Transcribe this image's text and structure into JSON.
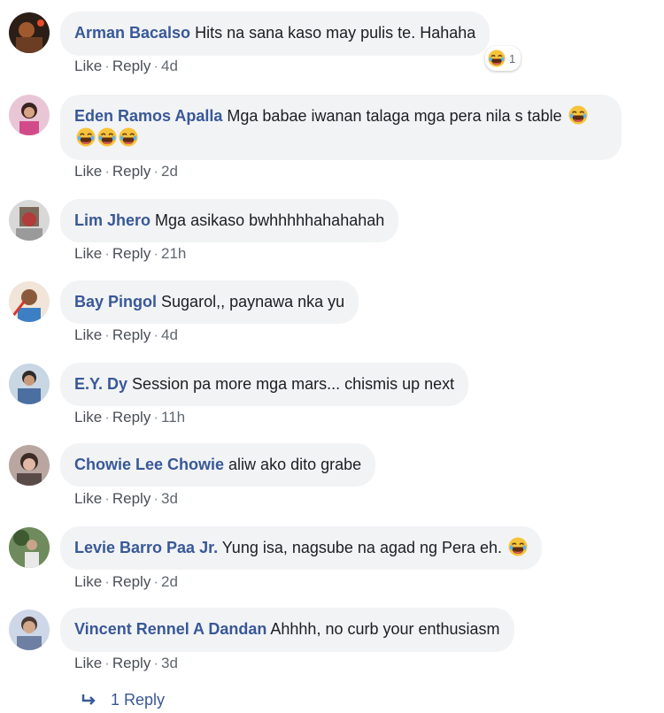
{
  "comments": [
    {
      "author": "Arman Bacalso",
      "text": "Hits na sana kaso may pulis te. Hahaha",
      "like": "Like",
      "reply": "Reply",
      "time": "4d",
      "reaction_count": "1",
      "avatar_color": "#5a3b2e"
    },
    {
      "author": "Eden Ramos Apalla",
      "text": "Mga babae iwanan talaga mga pera nila s table",
      "like": "Like",
      "reply": "Reply",
      "time": "2d",
      "avatar_color": "#c94f7c"
    },
    {
      "author": "Lim Jhero",
      "text": "Mga asikaso bwhhhhhahahahah",
      "like": "Like",
      "reply": "Reply",
      "time": "21h",
      "avatar_color": "#8b8b8b"
    },
    {
      "author": "Bay Pingol",
      "text": "Sugarol,, paynawa nka yu",
      "like": "Like",
      "reply": "Reply",
      "time": "4d",
      "avatar_color": "#d9534f"
    },
    {
      "author": "E.Y. Dy",
      "text": "Session pa more mga mars... chismis up next",
      "like": "Like",
      "reply": "Reply",
      "time": "11h",
      "avatar_color": "#6a8fb5"
    },
    {
      "author": "Chowie Lee Chowie",
      "text": "aliw ako dito grabe",
      "like": "Like",
      "reply": "Reply",
      "time": "3d",
      "avatar_color": "#7a5c5c"
    },
    {
      "author": "Levie Barro Paa Jr.",
      "text": "Yung isa, nagsube na agad ng Pera eh.",
      "like": "Like",
      "reply": "Reply",
      "time": "2d",
      "avatar_color": "#5c7a4a"
    },
    {
      "author": "Vincent Rennel A Dandan",
      "text": "Ahhhh, no curb your enthusiasm",
      "like": "Like",
      "reply": "Reply",
      "time": "3d",
      "avatar_color": "#6d7fa3"
    }
  ],
  "view_replies": "1 Reply",
  "colors": {
    "author": "#385898",
    "bubble": "#f2f3f5",
    "meta": "#606770"
  },
  "icons": {
    "laugh": "laughing-emoji-icon",
    "reply_arrow": "reply-arrow-icon"
  }
}
